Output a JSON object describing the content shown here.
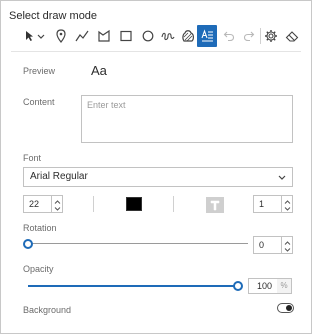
{
  "header": {
    "title": "Select draw mode"
  },
  "toolbar": {
    "tools": [
      {
        "icon": "select-arrow-icon"
      },
      {
        "icon": "point-icon"
      },
      {
        "icon": "polyline-icon"
      },
      {
        "icon": "polygon-icon"
      },
      {
        "icon": "rectangle-icon"
      },
      {
        "icon": "circle-icon"
      },
      {
        "icon": "freehand-line-icon"
      },
      {
        "icon": "freehand-polygon-icon"
      },
      {
        "icon": "text-icon",
        "active": true
      },
      {
        "icon": "undo-icon",
        "disabled": true
      },
      {
        "icon": "redo-icon",
        "disabled": true
      },
      {
        "icon": "gear-icon"
      },
      {
        "icon": "eraser-icon"
      }
    ]
  },
  "preview": {
    "label": "Preview",
    "sample": "Aa"
  },
  "content": {
    "label": "Content",
    "placeholder": "Enter text"
  },
  "font": {
    "label": "Font",
    "family": "Arial Regular",
    "size": "22",
    "color": "#000000",
    "halo_size": "1"
  },
  "rotation": {
    "label": "Rotation",
    "value": "0",
    "level": 0
  },
  "opacity": {
    "label": "Opacity",
    "value": "100",
    "unit": "%",
    "level": 1.0
  },
  "background": {
    "label": "Background",
    "enabled": false
  },
  "colors": {
    "accent": "#1e6bb8",
    "border": "#c2c2c2",
    "label": "#6b6b6b"
  }
}
